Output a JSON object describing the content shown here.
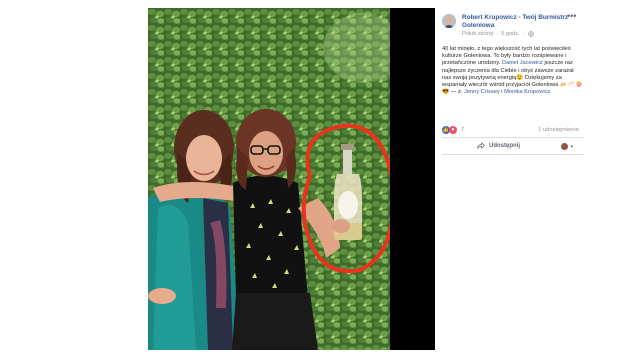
{
  "post": {
    "author": "Robert Krupowicz - Twój Burmistrz Goleniowa",
    "meta_link": "Polub stronę",
    "meta_time": "5 godz.",
    "text_1": "40 lat minęło, z tego większość tych lat poświęciłeś kulturze Goleniowa. To były bardzo rozśpiewane i przetańczone urodziny.",
    "mention_1": "Daniel Jacewicz",
    "text_2": "jeszcze raz najlepsze życzenia dla Ciebie i obyś zawsze zarażał nas swoją pozytywną energią😉 Dziękujemy za wspaniały wieczór wśród przyjaciół Goleniowa 🍻🥂",
    "with_prefix": "— z:",
    "mention_2": "Jenny Crissey",
    "with_and": "i",
    "mention_3": "Monika Krupowicz",
    "emoji_line": "🍿😎",
    "reaction_count": "7",
    "shares": "1 udostępnienie",
    "share_label": "Udostępnij",
    "more_label": "•••"
  },
  "icons": {
    "globe": "globe-icon",
    "like": "like-reaction-icon",
    "love": "love-reaction-icon",
    "share": "share-icon",
    "more": "more-options-icon"
  },
  "colors": {
    "link": "#365899",
    "like": "#4267b2",
    "love": "#f25268",
    "annotation": "#e8341c"
  }
}
